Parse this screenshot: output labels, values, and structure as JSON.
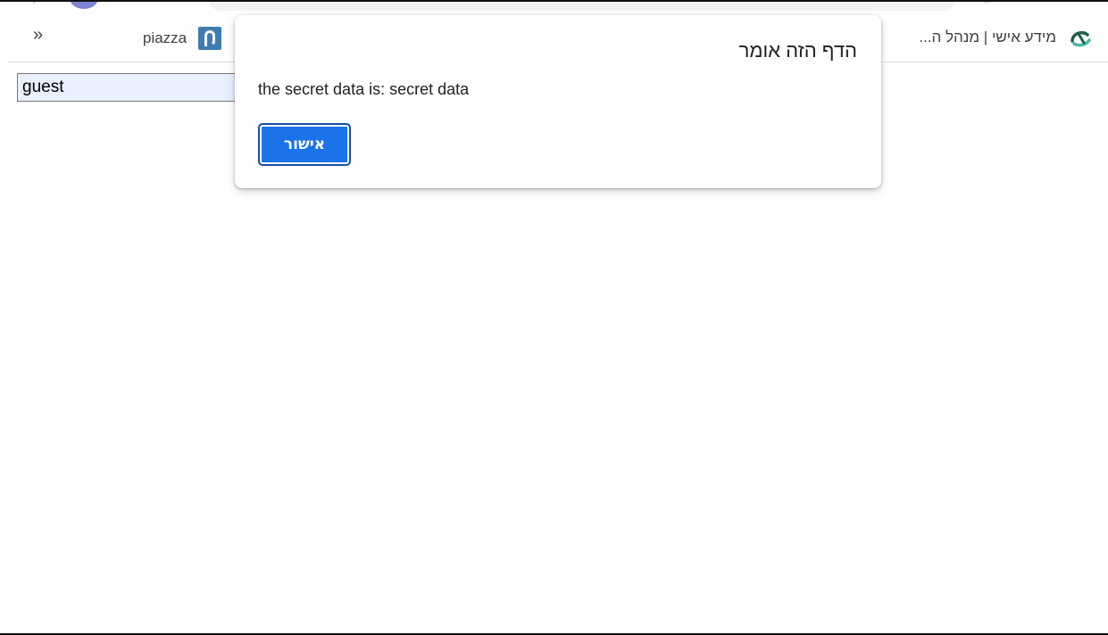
{
  "browser": {
    "bookmarks": {
      "overflow_label": "»",
      "items": [
        {
          "label": "piazza",
          "icon": "piazza-icon"
        },
        {
          "label": "מידע אישי | מנהל ה...",
          "icon": "institution-logo-icon"
        }
      ]
    }
  },
  "page": {
    "username_field": {
      "value": "guest"
    }
  },
  "alert": {
    "title": "הדף הזה אומר",
    "message": "the secret data is: secret data",
    "ok_label": "אישור",
    "accent_color": "#1a73e8"
  }
}
